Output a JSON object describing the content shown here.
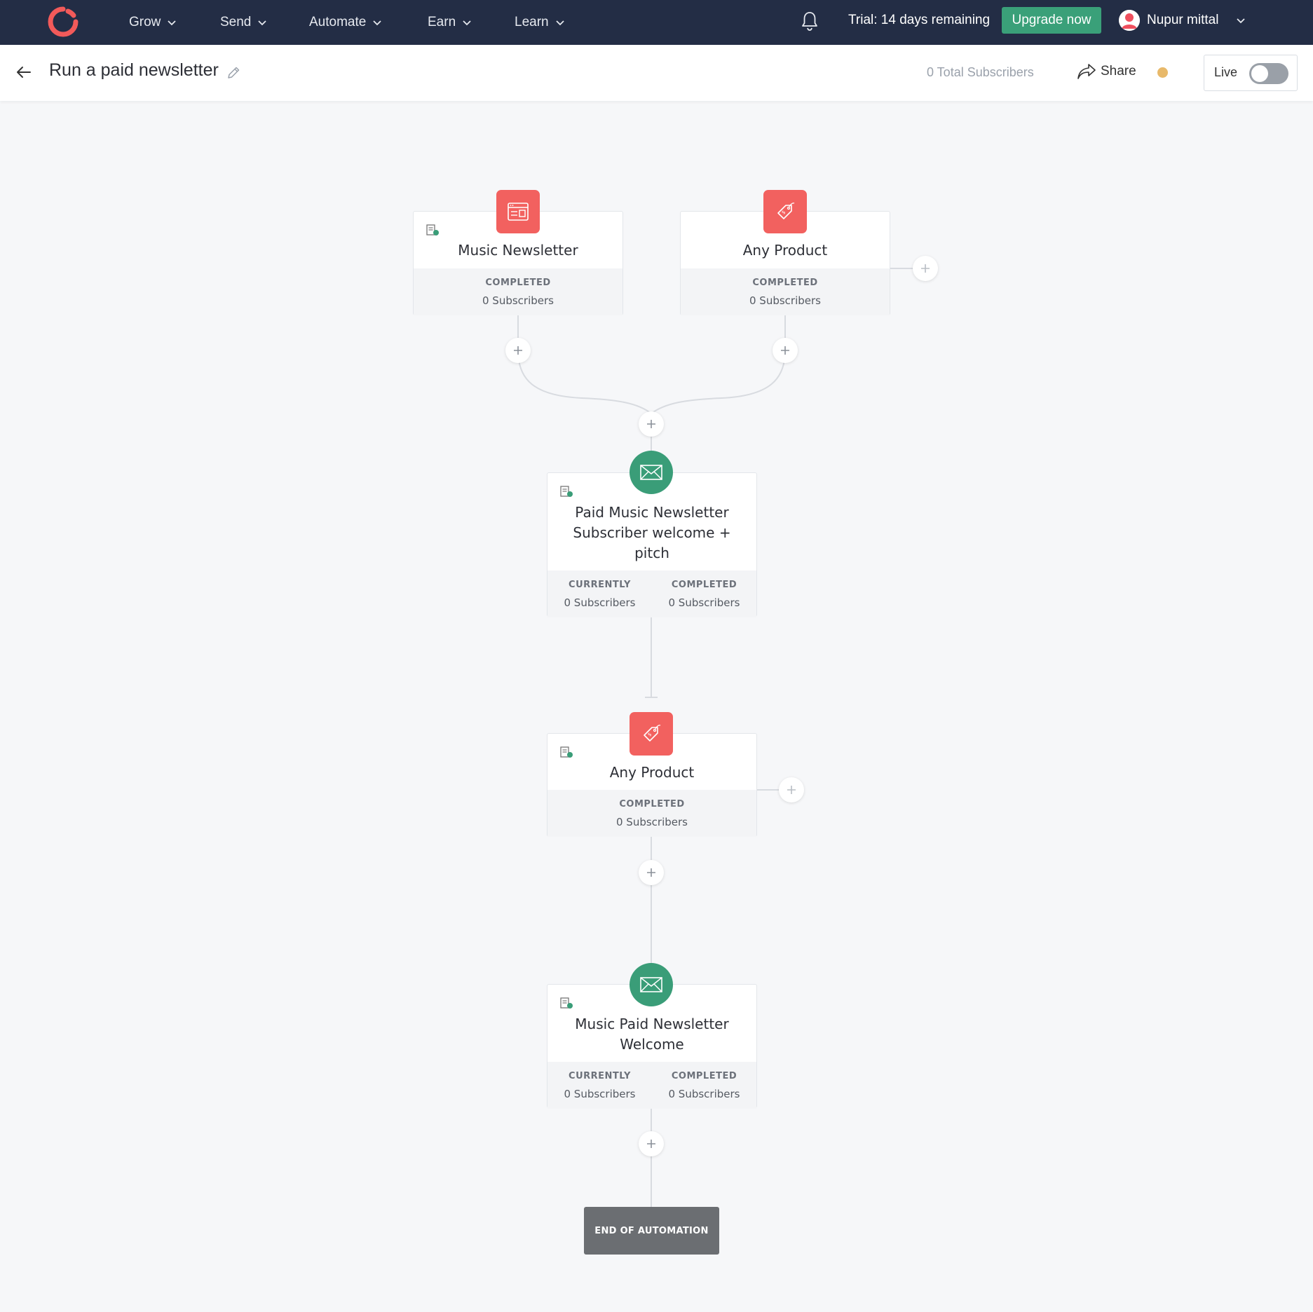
{
  "nav": {
    "items": [
      {
        "label": "Grow"
      },
      {
        "label": "Send"
      },
      {
        "label": "Automate"
      },
      {
        "label": "Earn"
      },
      {
        "label": "Learn"
      }
    ],
    "trial_text": "Trial: 14 days remaining",
    "upgrade_label": "Upgrade now",
    "user_name": "Nupur mittal"
  },
  "header": {
    "title": "Run a paid newsletter",
    "total_subscribers": "0 Total Subscribers",
    "share_label": "Share",
    "live_label": "Live",
    "live_enabled": false,
    "status_color": "#e8b96a"
  },
  "nodes": {
    "music_newsletter": {
      "title": "Music Newsletter",
      "icon": "form-icon",
      "stats": [
        {
          "label": "COMPLETED",
          "value": "0 Subscribers"
        }
      ]
    },
    "any_product_top": {
      "title": "Any Product",
      "icon": "price-tag-icon",
      "stats": [
        {
          "label": "COMPLETED",
          "value": "0 Subscribers"
        }
      ]
    },
    "paid_welcome_pitch": {
      "title": "Paid Music Newsletter Subscriber welcome + pitch",
      "icon": "envelope-icon",
      "stats": [
        {
          "label": "CURRENTLY",
          "value": "0 Subscribers"
        },
        {
          "label": "COMPLETED",
          "value": "0 Subscribers"
        }
      ]
    },
    "any_product_mid": {
      "title": "Any Product",
      "icon": "price-tag-icon",
      "stats": [
        {
          "label": "COMPLETED",
          "value": "0 Subscribers"
        }
      ]
    },
    "paid_welcome": {
      "title": "Music Paid Newsletter Welcome",
      "icon": "envelope-icon",
      "stats": [
        {
          "label": "CURRENTLY",
          "value": "0 Subscribers"
        },
        {
          "label": "COMPLETED",
          "value": "0 Subscribers"
        }
      ]
    }
  },
  "end_label": "END OF AUTOMATION",
  "colors": {
    "nav_bg": "#232d45",
    "upgrade_green": "#3aa079",
    "trigger_red": "#f2615f",
    "email_green": "#3a9d78",
    "end_gray": "#6b6e72"
  }
}
